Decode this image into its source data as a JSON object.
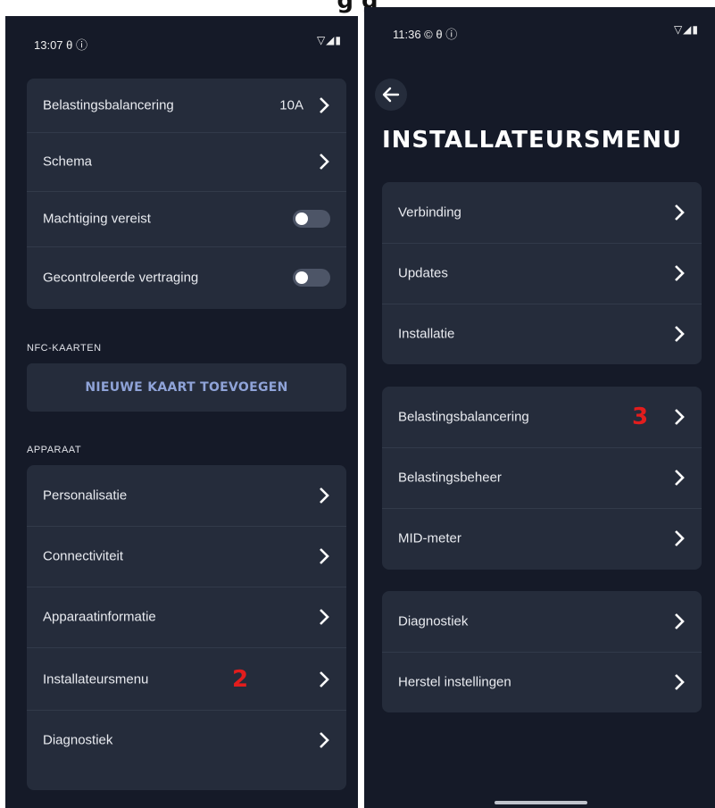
{
  "caption": "g      g",
  "left": {
    "status_time": "13:07 θ ⓘ",
    "status_icons": "▽◢▮",
    "settings": [
      {
        "label": "Belastingsbalancering",
        "value": "10A"
      },
      {
        "label": "Schema"
      },
      {
        "label": "Machtiging vereist"
      },
      {
        "label": "Gecontroleerde vertraging"
      }
    ],
    "nfc_section": "NFC-KAARTEN",
    "add_card_label": "NIEUWE KAART TOEVOEGEN",
    "device_section": "APPARAAT",
    "device_items": [
      {
        "label": "Personalisatie"
      },
      {
        "label": "Connectiviteit"
      },
      {
        "label": "Apparaatinformatie"
      },
      {
        "label": "Installateursmenu"
      },
      {
        "label": "Diagnostiek"
      }
    ],
    "step_badge": "2"
  },
  "right": {
    "status_time": "11:36 © θ ⓘ",
    "status_icons": "▽◢▮",
    "title": "INSTALLATEURSMENU",
    "group1": [
      {
        "label": "Verbinding"
      },
      {
        "label": "Updates"
      },
      {
        "label": "Installatie"
      }
    ],
    "group2": [
      {
        "label": "Belastingsbalancering"
      },
      {
        "label": "Belastingsbeheer"
      },
      {
        "label": "MID-meter"
      }
    ],
    "group3": [
      {
        "label": "Diagnostiek"
      },
      {
        "label": "Herstel instellingen"
      }
    ],
    "step_badge": "3"
  }
}
